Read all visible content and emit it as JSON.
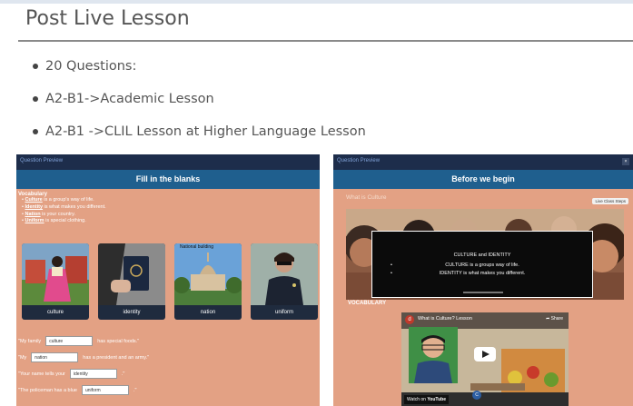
{
  "slide": {
    "title": "Post Live Lesson",
    "bullets": [
      "20 Questions:",
      "A2-B1->Academic Lesson",
      "A2-B1 ->CLIL Lesson at Higher Language Lesson"
    ]
  },
  "left_panel": {
    "topbar": "Question Preview",
    "header": "Fill in the blanks",
    "vocab_title": "Vocabulary",
    "vocab": [
      {
        "word": "Culture",
        "rest": " is a group's way of life."
      },
      {
        "word": "Identity",
        "rest": " is what makes you different."
      },
      {
        "word": "Nation",
        "rest": " is your country."
      },
      {
        "word": "Uniform",
        "rest": " is special clothing."
      }
    ],
    "cards": [
      {
        "label": "culture",
        "caption": ""
      },
      {
        "label": "identity",
        "caption": ""
      },
      {
        "label": "nation",
        "caption": "National building"
      },
      {
        "label": "uniform",
        "caption": ""
      }
    ],
    "sentences": [
      {
        "before": "\"My family",
        "answer": "culture",
        "after": "has special foods.\""
      },
      {
        "before": "\"My",
        "answer": "nation",
        "after": "has a president and an army.\""
      },
      {
        "before": "\"Your name tells your",
        "answer": "identity",
        "after": ".\""
      },
      {
        "before": "\"The policeman has a blue",
        "answer": "uniform",
        "after": ".\""
      }
    ]
  },
  "right_panel": {
    "topbar": "Question Preview",
    "header": "Before we begin",
    "what_is": "What is Culture",
    "live_button": "Live Class Steps",
    "box_title": "CULTURE and IDENTITY",
    "box_lines": [
      "CULTURE is a groups way of life.",
      "IDENTITY is what makes you different."
    ],
    "vocab_label": "VOCABULARY",
    "video": {
      "channel_initial": "d",
      "title": "What is Culture? Lesson",
      "share": "Share",
      "watch": "Watch on",
      "youtube": "YouTube"
    }
  },
  "colors": {
    "panel_bg": "#e3a184",
    "panel_header": "#1f5f8e",
    "panel_topbar": "#1d2d4b",
    "title_text": "#555555"
  }
}
